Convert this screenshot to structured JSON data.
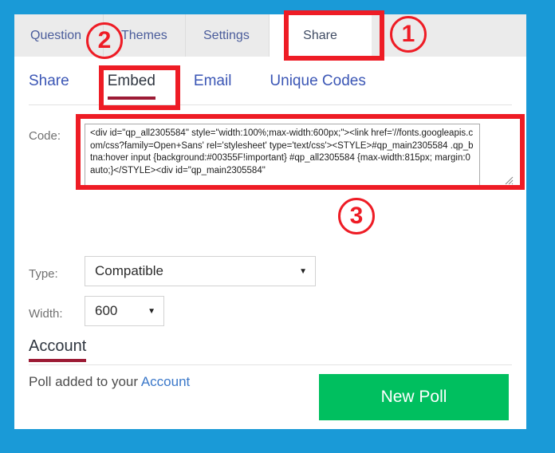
{
  "window": {
    "background_color": "#1a9ad7",
    "card_background": "#ffffff"
  },
  "main_tabs": [
    {
      "label": "Question",
      "active": false
    },
    {
      "label": "Themes",
      "active": false
    },
    {
      "label": "Settings",
      "active": false
    },
    {
      "label": "Share",
      "active": true
    }
  ],
  "sub_tabs": [
    {
      "label": "Share",
      "active": false
    },
    {
      "label": "Embed",
      "active": true
    },
    {
      "label": "Email",
      "active": false
    },
    {
      "label": "Unique Codes",
      "active": false
    }
  ],
  "embed_form": {
    "code_label": "Code:",
    "code_value": "<div id=\"qp_all2305584\" style=\"width:100%;max-width:600px;\"><link href='//fonts.googleapis.com/css?family=Open+Sans' rel='stylesheet' type='text/css'><STYLE>#qp_main2305584 .qp_btna:hover input {background:#00355F!important} #qp_all2305584 {max-width:815px; margin:0 auto;}</STYLE><div id=\"qp_main2305584\"",
    "type_label": "Type:",
    "type_value": "Compatible",
    "width_label": "Width:",
    "width_value": "600",
    "caret_glyph": "▼"
  },
  "account": {
    "heading": "Account",
    "message_prefix": "Poll added to your ",
    "message_link": "Account",
    "underline_color": "#9c1b35"
  },
  "actions": {
    "new_poll_label": "New Poll",
    "new_poll_color": "#00bf5f"
  },
  "annotations": {
    "color": "#ee1c25",
    "markers": [
      {
        "id": "1",
        "label": "1"
      },
      {
        "id": "2",
        "label": "2"
      },
      {
        "id": "3",
        "label": "3"
      }
    ]
  }
}
